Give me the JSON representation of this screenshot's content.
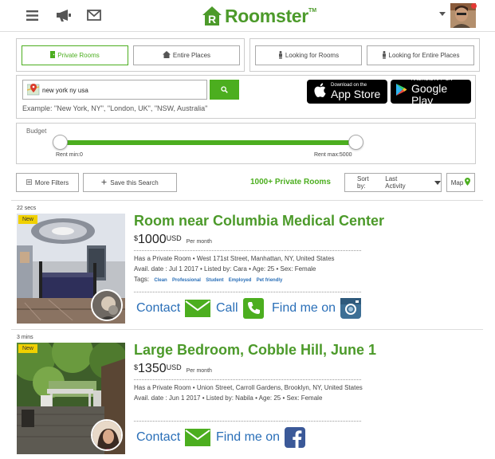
{
  "header": {
    "brand": "Roomster",
    "trademark": "TM"
  },
  "tabs": [
    {
      "label": "Private Rooms",
      "icon": "door-icon",
      "active": true
    },
    {
      "label": "Entire Places",
      "icon": "house-icon",
      "active": false
    },
    {
      "label": "Looking for Rooms",
      "icon": "person-icon",
      "active": false
    },
    {
      "label": "Looking for Entire Places",
      "icon": "person-icon",
      "active": false
    }
  ],
  "search": {
    "value": "new york ny usa",
    "example": "Example: \"New York, NY\", \"London, UK\", \"NSW, Australia\""
  },
  "stores": {
    "apple_small": "Download on the",
    "apple_big": "App Store",
    "google_small": "ANDROID APP ON",
    "google_big": "Google Play"
  },
  "budget": {
    "label": "Budget",
    "min_label": "Rent min:",
    "min_value": "0",
    "max_label": "Rent max:",
    "max_value": "5000"
  },
  "filters": {
    "more_filters": "More Filters",
    "save_search": "Save this Search",
    "count": "1000+ Private Rooms",
    "sort_label": "Sort by:",
    "sort_value": "Last Activity",
    "map": "Map"
  },
  "listings": [
    {
      "ago": "22 secs",
      "badge": "New",
      "title": "Room near Columbia Medical Center",
      "currency_symbol": "$",
      "price": "1000",
      "currency": "USD",
      "period": "Per month",
      "line1": "Has a Private Room • West 171st Street, Manhattan, NY, United States",
      "line2": "Avail. date : Jul 1 2017 • Listed by: Cara • Age: 25 • Sex: Female",
      "tags_label": "Tags:",
      "tags": [
        "Clean",
        "Professional",
        "Student",
        "Employed",
        "Pet friendly"
      ],
      "actions": [
        "Contact",
        "Call",
        "Find me on"
      ]
    },
    {
      "ago": "3 mins",
      "badge": "New",
      "title": "Large Bedroom, Cobble Hill, June 1",
      "currency_symbol": "$",
      "price": "1350",
      "currency": "USD",
      "period": "Per month",
      "line1": "Has a Private Room • Union Street, Carroll Gardens, Brooklyn, NY, United States",
      "line2": "Avail. date : Jun 1 2017 • Listed by: Nabila • Age: 25 • Sex: Female",
      "actions": [
        "Contact",
        "Find me on"
      ]
    }
  ],
  "colors": {
    "brand_green": "#4c9a2a",
    "accent_green": "#4cae1f",
    "link_blue": "#2a6fb8",
    "badge_yellow": "#f0d000"
  }
}
